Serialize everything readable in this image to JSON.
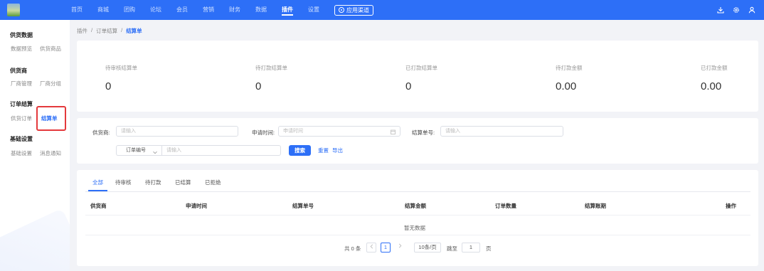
{
  "topbar": {
    "nav": [
      "首页",
      "商城",
      "团购",
      "论坛",
      "会员",
      "营销",
      "财务",
      "数据",
      "插件",
      "设置"
    ],
    "active_index": 8,
    "app_center": "应用渠道",
    "brand_color": "#2d6ff7"
  },
  "sidebar": {
    "groups": [
      {
        "title": "供货数据",
        "items": [
          "数据预览",
          "供货商品"
        ]
      },
      {
        "title": "供货商",
        "items": [
          "厂商管理",
          "厂商分组"
        ]
      },
      {
        "title": "订单结算",
        "items": [
          "供货订单",
          "结算单"
        ]
      },
      {
        "title": "基础设置",
        "items": [
          "基础设置",
          "消息通知"
        ]
      }
    ],
    "active_item": "结算单",
    "highlight_color": "#e4393c"
  },
  "breadcrumb": {
    "items": [
      "插件",
      "订单结算",
      "结算单"
    ],
    "separator": "/"
  },
  "stats": [
    {
      "label": "待审核结算单",
      "value": "0"
    },
    {
      "label": "待打款结算单",
      "value": "0"
    },
    {
      "label": "已打款结算单",
      "value": "0"
    },
    {
      "label": "待打款金额",
      "value": "0.00"
    },
    {
      "label": "已打款金额",
      "value": "0.00"
    }
  ],
  "filters": {
    "supplier_label": "供货商:",
    "supplier_placeholder": "请输入",
    "apply_time_label": "申请时间:",
    "apply_time_placeholder": "申请时间",
    "settle_no_label": "结算单号:",
    "settle_no_placeholder": "请输入",
    "order_select": "订单编号",
    "order_placeholder": "请输入",
    "search_button": "搜索",
    "reset_button": "重置",
    "export_button": "导出"
  },
  "tabs": {
    "items": [
      "全部",
      "待审核",
      "待打款",
      "已结算",
      "已拒绝"
    ],
    "active_index": 0
  },
  "table": {
    "columns": [
      "供货商",
      "申请时间",
      "结算单号",
      "结算金额",
      "订单数量",
      "结算账期",
      "操作"
    ],
    "empty_text": "暂无数据"
  },
  "pagination": {
    "total_text": "共 0 条",
    "current_page": "1",
    "page_size": "10条/页",
    "goto_label": "跳至",
    "goto_value": "1",
    "page_suffix": "页"
  }
}
